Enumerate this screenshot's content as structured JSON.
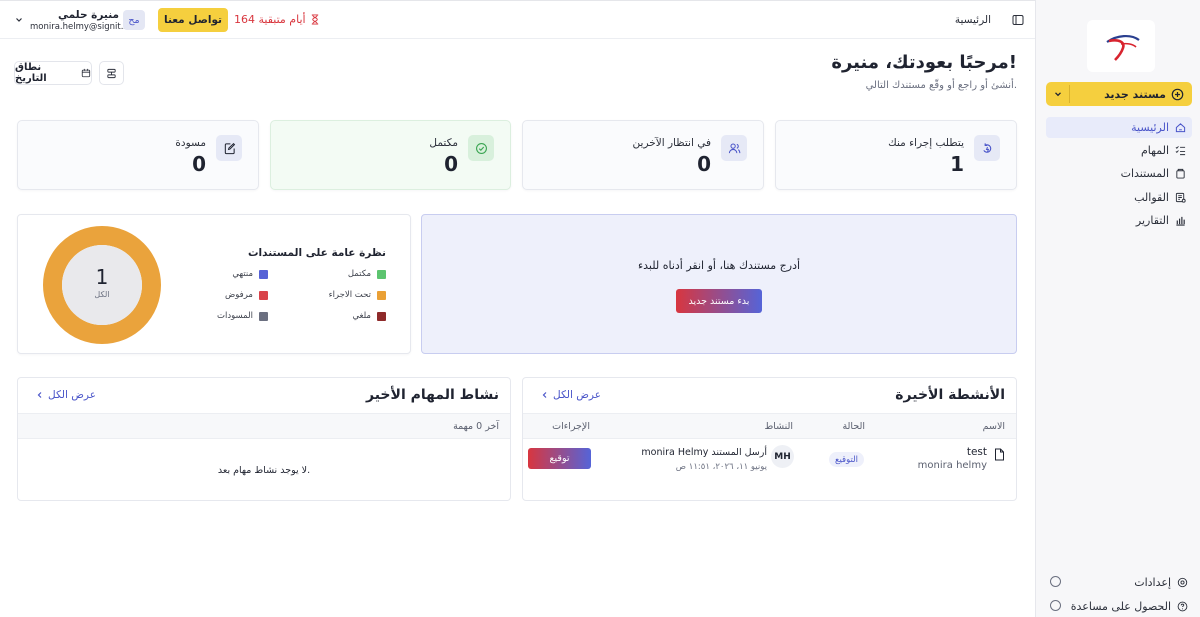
{
  "sidebar": {
    "new_doc": "مستند جديد",
    "items": [
      {
        "label": "الرئيسية",
        "icon": "home-icon",
        "active": true
      },
      {
        "label": "المهام",
        "icon": "tasks-icon",
        "active": false
      },
      {
        "label": "المستندات",
        "icon": "documents-icon",
        "active": false
      },
      {
        "label": "القوالب",
        "icon": "templates-icon",
        "active": false
      },
      {
        "label": "التقارير",
        "icon": "reports-icon",
        "active": false
      }
    ],
    "footer": {
      "settings": "إعدادات",
      "help": "الحصول على مساعدة"
    }
  },
  "topbar": {
    "breadcrumb": "الرئيسية",
    "trial": "164 أيام متبقية",
    "contact": "تواصل معنا",
    "user": {
      "name": "منيرة حلمي",
      "email": "monira.helmy@signit.sa",
      "initials": "مح"
    }
  },
  "header": {
    "title": "مرحبًا بعودتك، منيرة!",
    "subtitle": "أنشئ أو راجع أو وقّع مستندك التالي.",
    "date_range": "نطاق التاريخ"
  },
  "stats": [
    {
      "label": "يتطلب إجراء منك",
      "value": "1",
      "icon": "action-required-icon"
    },
    {
      "label": "في انتظار الآخرين",
      "value": "0",
      "icon": "users-icon"
    },
    {
      "label": "مكتمل",
      "value": "0",
      "icon": "check-circle-icon"
    },
    {
      "label": "مسودة",
      "value": "0",
      "icon": "draft-edit-icon"
    }
  ],
  "drop": {
    "text": "أدرج مستندك هنا، أو انقر أدناه للبدء",
    "button": "بدء مستند جديد"
  },
  "overview": {
    "title": "نظرة عامة على المستندات",
    "total": "1",
    "total_label": "الكل",
    "legend": [
      {
        "label": "مكتمل",
        "color": "#5cc46f"
      },
      {
        "label": "منتهي",
        "color": "#5662d6"
      },
      {
        "label": "تحت الاجراء",
        "color": "#eaa035"
      },
      {
        "label": "مرفوض",
        "color": "#d9434a"
      },
      {
        "label": "ملغي",
        "color": "#8e2a2a"
      },
      {
        "label": "المسودات",
        "color": "#6b6f80"
      }
    ],
    "donut_fraction_in_progress": 1.0,
    "donut_color": "#eaa33c"
  },
  "recent": {
    "title": "الأنشطة الأخيرة",
    "view_all": "عرض الكل",
    "columns": {
      "name": "الاسم",
      "status": "الحالة",
      "activity": "النشاط",
      "actions": "الإجراءات"
    },
    "rows": [
      {
        "name": "test",
        "owner": "monira helmy",
        "status": "التوقيع",
        "avatar": "MH",
        "activity": "monira Helmy أرسل المستند",
        "date": "يونيو ١١، ٢٠٢٦، ١١:٥١ ص",
        "action": "توقيع"
      }
    ]
  },
  "tasks": {
    "title": "نشاط المهام الأخير",
    "view_all": "عرض الكل",
    "count": "آخر 0 مهمة",
    "empty": "لا يوجد نشاط مهام بعد."
  }
}
